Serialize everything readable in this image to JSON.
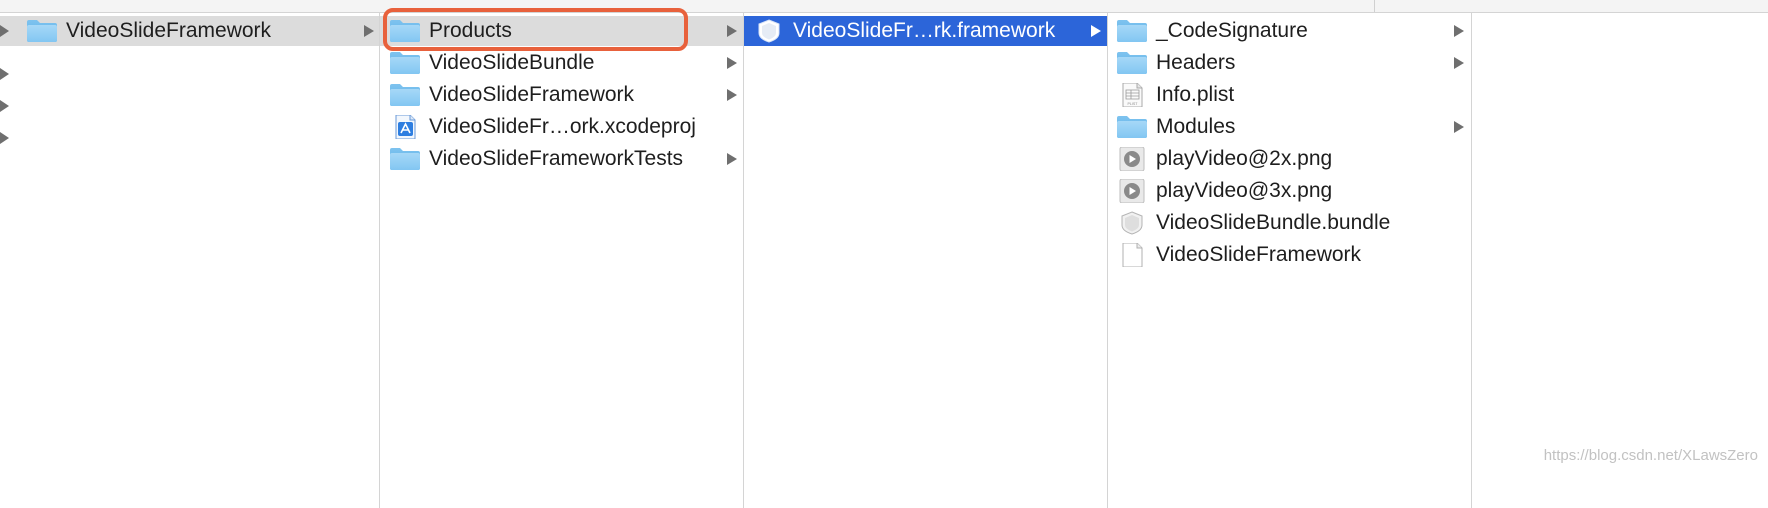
{
  "columns": {
    "col1": {
      "items": [
        {
          "name": "VideoSlideFramework",
          "icon": "folder-icon"
        }
      ]
    },
    "col2": {
      "items": [
        {
          "name": "Products",
          "icon": "folder-icon"
        },
        {
          "name": "VideoSlideBundle",
          "icon": "folder-icon"
        },
        {
          "name": "VideoSlideFramework",
          "icon": "folder-icon"
        },
        {
          "name": "VideoSlideFr…ork.xcodeproj",
          "icon": "xcodeproj-icon"
        },
        {
          "name": "VideoSlideFrameworkTests",
          "icon": "folder-icon"
        }
      ]
    },
    "col3": {
      "items": [
        {
          "name": "VideoSlideFr…rk.framework",
          "icon": "framework-icon"
        }
      ]
    },
    "col4": {
      "items": [
        {
          "name": "_CodeSignature",
          "icon": "folder-icon"
        },
        {
          "name": "Headers",
          "icon": "folder-icon"
        },
        {
          "name": "Info.plist",
          "icon": "plist-file-icon",
          "icon_text": "PLIST"
        },
        {
          "name": "Modules",
          "icon": "folder-icon"
        },
        {
          "name": "playVideo@2x.png",
          "icon": "png-image-icon"
        },
        {
          "name": "playVideo@3x.png",
          "icon": "png-image-icon"
        },
        {
          "name": "VideoSlideBundle.bundle",
          "icon": "bundle-icon"
        },
        {
          "name": "VideoSlideFramework",
          "icon": "document-icon"
        }
      ]
    }
  },
  "selection_color": "#2c65d9",
  "highlight_color": "#e8613c",
  "watermark": "https://blog.csdn.net/XLawsZero"
}
